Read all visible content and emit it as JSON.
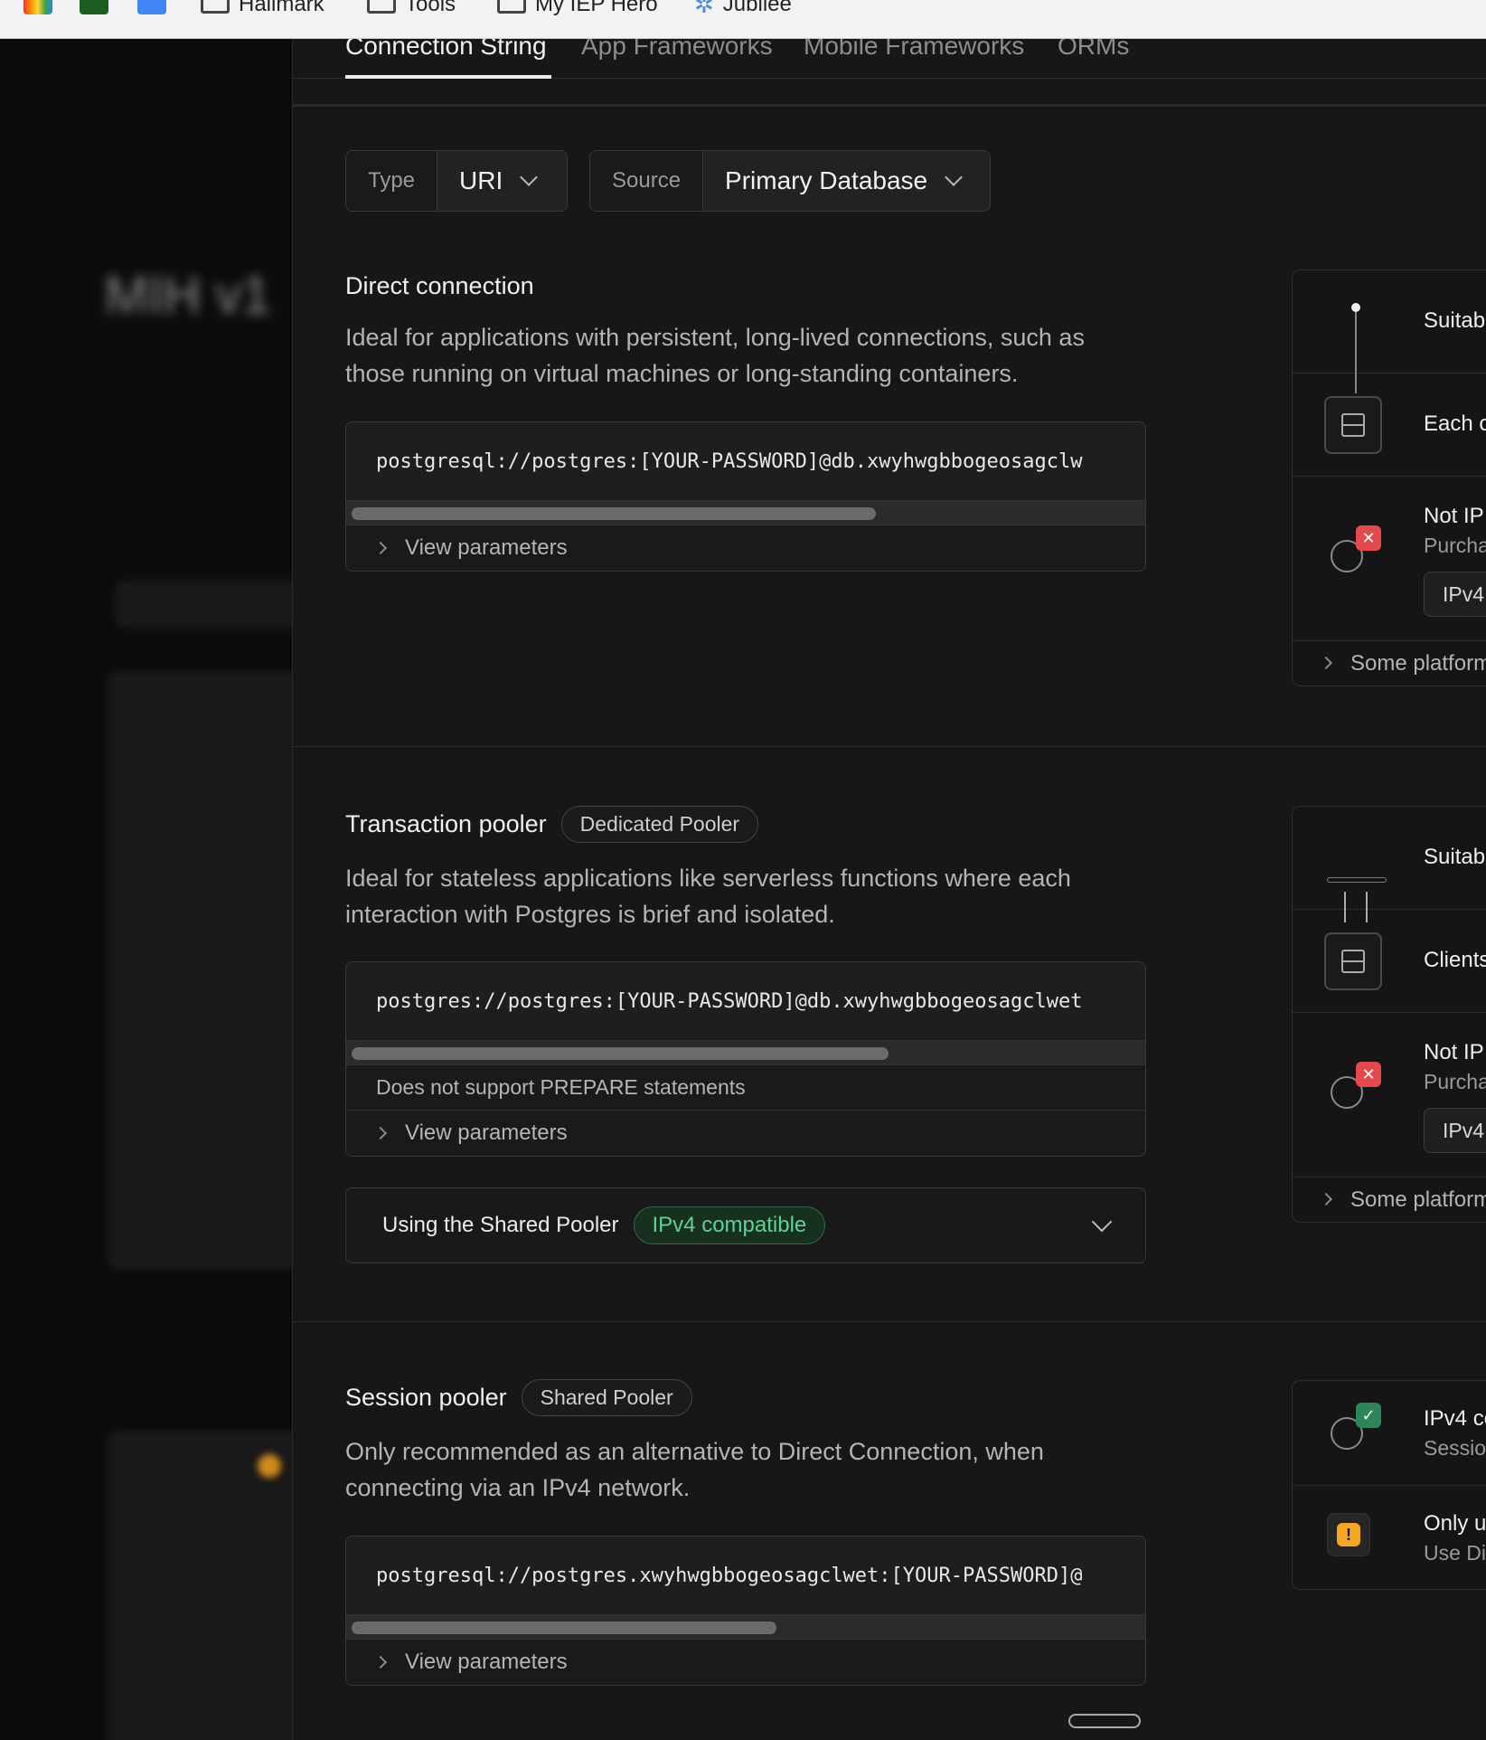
{
  "bookmarks": [
    {
      "label": "Hallmark"
    },
    {
      "label": "Tools"
    },
    {
      "label": "My IEP Hero"
    },
    {
      "label": "Jubilee"
    }
  ],
  "tabs": [
    {
      "label": "Connection String"
    },
    {
      "label": "App Frameworks"
    },
    {
      "label": "Mobile Frameworks"
    },
    {
      "label": "ORMs"
    }
  ],
  "selectors": {
    "type_label": "Type",
    "type_value": "URI",
    "source_label": "Source",
    "source_value": "Primary Database"
  },
  "direct": {
    "title": "Direct connection",
    "description": "Ideal for applications with persistent, long-lived connections, such as those running on virtual machines or long-standing containers.",
    "connection_string": "postgresql://postgres:[YOUR-PASSWORD]@db.xwyhwgbbogeosagclw",
    "params_label": "View parameters",
    "card": {
      "row1": "Suitab",
      "row2": "Each c",
      "row3_title": "Not IP",
      "row3_sub": "Purcha",
      "row3_button": "IPv4",
      "footer": "Some platform"
    }
  },
  "transaction": {
    "title": "Transaction pooler",
    "badge": "Dedicated Pooler",
    "description": "Ideal for stateless applications like serverless functions where each interaction with Postgres is brief and isolated.",
    "connection_string": "postgres://postgres:[YOUR-PASSWORD]@db.xwyhwgbbogeosagclwet",
    "note": "Does not support PREPARE statements",
    "params_label": "View parameters",
    "shared_label": "Using the Shared Pooler",
    "shared_badge": "IPv4 compatible",
    "card": {
      "row1": "Suitab",
      "row2": "Clients",
      "row3_title": "Not IP",
      "row3_sub": "Purcha",
      "row3_button": "IPv4",
      "footer": "Some platform"
    }
  },
  "session": {
    "title": "Session pooler",
    "badge": "Shared Pooler",
    "description": "Only recommended as an alternative to Direct Connection, when connecting via an IPv4 network.",
    "connection_string": "postgresql://postgres.xwyhwgbbogeosagclwet:[YOUR-PASSWORD]@",
    "params_label": "View parameters",
    "card": {
      "row1_title": "IPv4 co",
      "row1_sub": "Sessio",
      "row2_title": "Only u",
      "row2_sub": "Use Di"
    }
  },
  "background": {
    "project_title": "MIH v1"
  },
  "colors": {
    "success": "#3ecf8e",
    "error": "#e5484d",
    "warning": "#f5a623"
  }
}
